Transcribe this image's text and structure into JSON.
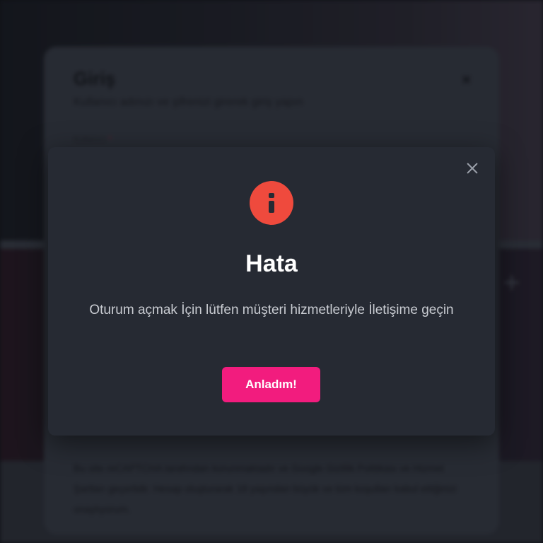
{
  "background": {
    "logo_text": "",
    "login": {
      "title": "Giriş",
      "subtitle": "Kullanıcı adınızı ve şifrenizi girerek giriş yapın",
      "close_glyph": "×",
      "field_label": "Kullanıcı",
      "required_mark": "*",
      "footer_text": "Bu site reCAPTCHA tarafından korunmaktadır ve Google Gizlilik Politikası ve Hizmet Şartları geçerlidir. Hesap oluşturarak 18 yaşından büyük ve tüm koşulları kabul ettiğinizi onaylıyorum."
    }
  },
  "dialog": {
    "icon": "info-icon",
    "icon_color": "#ef4a3d",
    "title": "Hata",
    "message": "Oturum açmak İçin lütfen müşteri hizmetleriyle İletişime geçin",
    "button_label": "Anladım!",
    "button_color": "#f21c7e",
    "close_icon": "close-icon"
  }
}
